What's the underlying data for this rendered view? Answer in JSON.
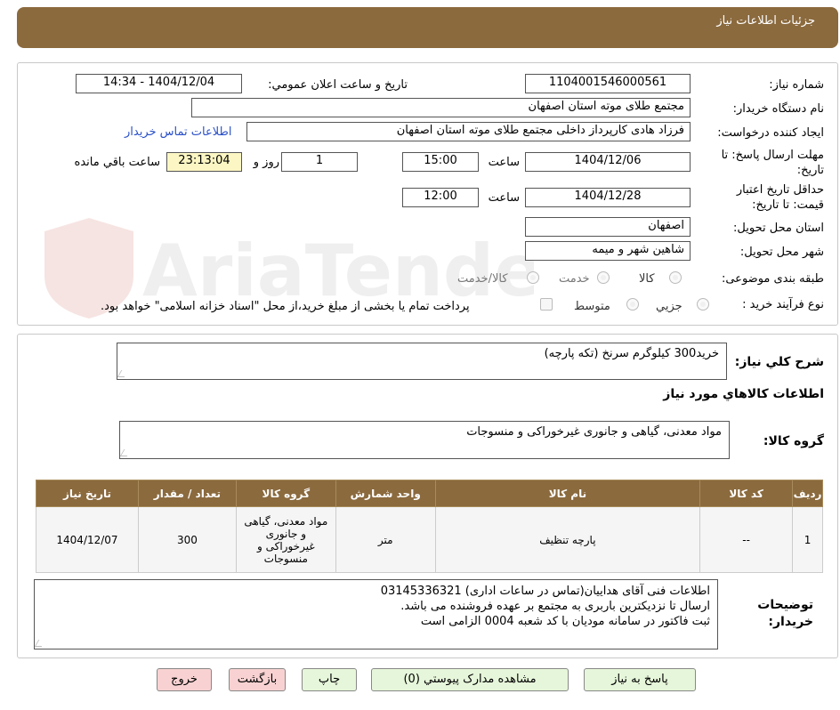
{
  "header": {
    "title": "جزئیات اطلاعات نیاز"
  },
  "form": {
    "need_number_label": "شماره نیاز:",
    "need_number": "1104001546000561",
    "announce_label": "تاریخ و ساعت اعلان عمومي:",
    "announce_value": "1404/12/04 - 14:34",
    "buyer_org_label": "نام دستگاه خریدار:",
    "buyer_org": "مجتمع طلای موته استان اصفهان",
    "creator_label": "ایجاد کننده درخواست:",
    "creator": "فرزاد هادی کارپرداز داخلی مجتمع طلای موته استان اصفهان",
    "contact_link": "اطلاعات تماس خریدار",
    "deadline_label_1": "مهلت ارسال پاسخ: تا",
    "deadline_label_2": "تاریخ:",
    "deadline_date": "1404/12/06",
    "time_label": "ساعت",
    "deadline_time": "15:00",
    "days_value": "1",
    "days_label": "روز و",
    "remaining_value": "23:13:04",
    "remaining_label": "ساعت باقي مانده",
    "validity_label_1": "حداقل تاریخ اعتبار",
    "validity_label_2": "قیمت: تا تاریخ:",
    "validity_date": "1404/12/28",
    "validity_time": "12:00",
    "province_label": "استان محل تحویل:",
    "province": "اصفهان",
    "city_label": "شهر محل تحویل:",
    "city": "شاهین شهر و میمه",
    "category_label": "طبقه بندی موضوعی:",
    "category_options": [
      "کالا",
      "خدمت",
      "کالا/خدمت"
    ],
    "process_label": "نوع فرآیند خرید :",
    "process_options": [
      "جزیي",
      "متوسط"
    ],
    "payment_note": "پرداخت تمام یا بخشی از مبلغ خرید،از محل \"اسناد خزانه اسلامی\" خواهد بود."
  },
  "summary": {
    "label": "شرح کلي نیاز:",
    "value": "خرید300 کیلوگرم سرنخ (تکه پارچه)",
    "goods_info_title": "اطلاعات کالاهاي مورد نیاز",
    "group_label": "گروه کالا:",
    "group_value": "مواد معدنی، گیاهی و جانوری غیرخوراکی و منسوجات"
  },
  "table": {
    "headers": [
      "ردیف",
      "کد کالا",
      "نام کالا",
      "واحد شمارش",
      "گروه کالا",
      "تعداد / مقدار",
      "تاریخ نیاز"
    ],
    "rows": [
      [
        "1",
        "--",
        "پارچه تنظیف",
        "متر",
        "مواد معدنی، گیاهی و جانوری غیرخوراکی و منسوجات",
        "300",
        "1404/12/07"
      ]
    ]
  },
  "notes": {
    "label_1": "توضیحات",
    "label_2": "خریدار:",
    "line1": "اطلاعات فنی آقای هداییان(تماس در ساعات اداری) 03145336321",
    "line2": "ارسال تا نزدیکترین باربری به مجتمع بر عهده فروشنده می باشد.",
    "line3": "ثبت فاکتور در سامانه مودیان با کد شعبه 0004 الزامی است"
  },
  "buttons": {
    "reply": "پاسخ به نیاز",
    "attachments": "مشاهده مدارک پیوستي (0)",
    "print": "چاپ",
    "back": "بازگشت",
    "exit": "خروج"
  },
  "colors": {
    "header": "#8b6a3e",
    "accent_link": "#2a50c8",
    "highlight": "#fbf6c3"
  },
  "watermark": {
    "text": "AriaTender.neT"
  }
}
